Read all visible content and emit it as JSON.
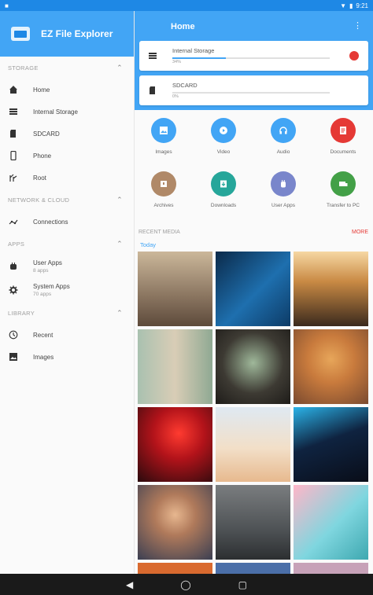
{
  "status_bar": {
    "time": "9:21"
  },
  "sidebar": {
    "app_title": "EZ File Explorer",
    "sections": {
      "storage": "STORAGE",
      "network": "NETWORK & CLOUD",
      "apps": "APPS",
      "library": "LIBRARY"
    },
    "storage_items": [
      {
        "label": "Home",
        "icon": "home-icon"
      },
      {
        "label": "Internal Storage",
        "icon": "storage-icon"
      },
      {
        "label": "SDCARD",
        "icon": "sdcard-icon"
      },
      {
        "label": "Phone",
        "icon": "phone-icon"
      },
      {
        "label": "Root",
        "icon": "root-icon"
      }
    ],
    "network_items": [
      {
        "label": "Connections",
        "icon": "connections-icon"
      }
    ],
    "apps_items": [
      {
        "label": "User Apps",
        "sub": "8 apps",
        "icon": "user-apps-icon"
      },
      {
        "label": "System Apps",
        "sub": "70 apps",
        "icon": "system-apps-icon"
      }
    ],
    "library_items": [
      {
        "label": "Recent",
        "icon": "recent-icon"
      },
      {
        "label": "Images",
        "icon": "images-icon"
      }
    ]
  },
  "main": {
    "title": "Home",
    "storage_cards": [
      {
        "name": "Internal Storage",
        "percent": "34%",
        "fill": 0.34
      },
      {
        "name": "SDCARD",
        "percent": "0%",
        "fill": 0.0
      }
    ],
    "categories": [
      {
        "label": "Images",
        "color": "#42a5f5",
        "icon": "images-icon"
      },
      {
        "label": "Video",
        "color": "#42a5f5",
        "icon": "video-icon"
      },
      {
        "label": "Audio",
        "color": "#42a5f5",
        "icon": "audio-icon"
      },
      {
        "label": "Documents",
        "color": "#e53935",
        "icon": "documents-icon"
      },
      {
        "label": "Archives",
        "color": "#b08968",
        "icon": "archives-icon"
      },
      {
        "label": "Downloads",
        "color": "#26a69a",
        "icon": "downloads-icon"
      },
      {
        "label": "User Apps",
        "color": "#7986cb",
        "icon": "user-apps-icon"
      },
      {
        "label": "Transfer to PC",
        "color": "#43a047",
        "icon": "transfer-icon"
      }
    ],
    "recent": {
      "title": "RECENT MEDIA",
      "more": "MORE",
      "today": "Today"
    }
  },
  "accent": "#42a5f5"
}
